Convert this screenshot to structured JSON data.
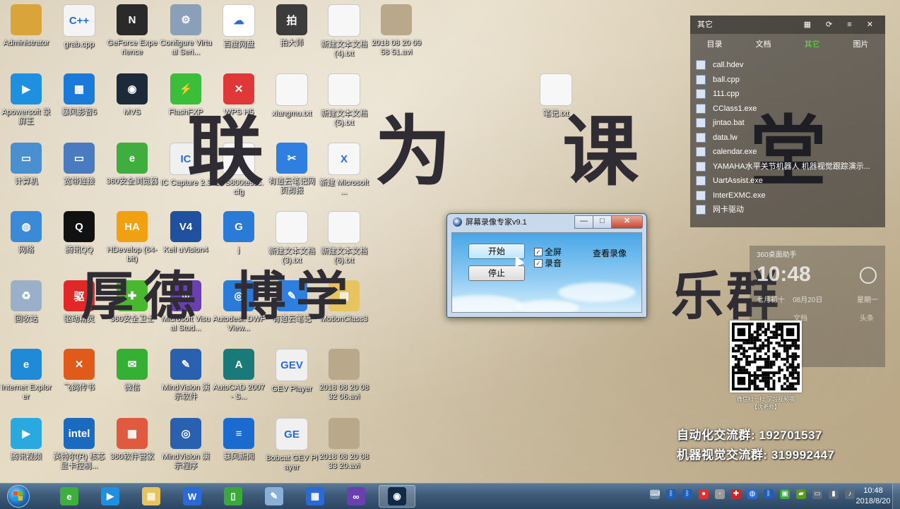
{
  "desktop": {
    "icons": [
      {
        "label": "Administrator",
        "color": "#d9a53a",
        "glyph": ""
      },
      {
        "label": "grab.cpp",
        "color": "#f4f4f4",
        "glyph": "C++"
      },
      {
        "label": "GeForce Experience",
        "color": "#2a2a2a",
        "glyph": "N"
      },
      {
        "label": "Configure Virtual Seri...",
        "color": "#8aa0b8",
        "glyph": "⚙"
      },
      {
        "label": "百度网盘",
        "color": "#ffffff",
        "glyph": "☁"
      },
      {
        "label": "拍大师",
        "color": "#3c3c3c",
        "glyph": "拍"
      },
      {
        "label": "新建文本文档 (4).txt",
        "color": "#f7f7f7",
        "glyph": ""
      },
      {
        "label": "2018 08 20 09 58 51.avi",
        "color": "#b9a98a",
        "glyph": ""
      },
      {
        "label": "Apowersoft 录屏王",
        "color": "#1f8fe0",
        "glyph": "▶"
      },
      {
        "label": "暴风影音5",
        "color": "#1a7ad9",
        "glyph": "▦"
      },
      {
        "label": "MVS",
        "color": "#1c2a3a",
        "glyph": "◉"
      },
      {
        "label": "FlashFXP",
        "color": "#3bbf3b",
        "glyph": "⚡"
      },
      {
        "label": "WPS H5",
        "color": "#e03838",
        "glyph": "✕"
      },
      {
        "label": "xiangmu.txt",
        "color": "#f7f7f7",
        "glyph": ""
      },
      {
        "label": "新建文本文档 (5).txt",
        "color": "#f7f7f7",
        "glyph": ""
      },
      {
        "label": "笔记.txt",
        "color": "#f7f7f7",
        "glyph": ""
      },
      {
        "label": "计算机",
        "color": "#4a8fd0",
        "glyph": "▭"
      },
      {
        "label": "宽带连接",
        "color": "#4a7ac0",
        "glyph": "▭"
      },
      {
        "label": "360安全浏览器",
        "color": "#3fae3f",
        "glyph": "e"
      },
      {
        "label": "IC Capture 2.3",
        "color": "#f0f0f0",
        "glyph": "IC"
      },
      {
        "label": "GTS800testic.cfg",
        "color": "#f7f7f7",
        "glyph": ""
      },
      {
        "label": "有道云笔记网页剪报",
        "color": "#2e7fe0",
        "glyph": "✂"
      },
      {
        "label": "新建 Microsoft ...",
        "color": "#f7f7f7",
        "glyph": "X"
      },
      {
        "label": "网络",
        "color": "#3a8ad8",
        "glyph": "◍"
      },
      {
        "label": "腾讯QQ",
        "color": "#111111",
        "glyph": "Q"
      },
      {
        "label": "HDevelop (64-bit)",
        "color": "#f0a010",
        "glyph": "HA"
      },
      {
        "label": "Keil uVision4",
        "color": "#2050a0",
        "glyph": "V4"
      },
      {
        "label": "j",
        "color": "#2a7ad8",
        "glyph": "G"
      },
      {
        "label": "新建文本文档 (3).txt",
        "color": "#f7f7f7",
        "glyph": ""
      },
      {
        "label": "新建文本文档 (6).txt",
        "color": "#f7f7f7",
        "glyph": ""
      },
      {
        "label": "回收站",
        "color": "#9ab0c8",
        "glyph": "♻"
      },
      {
        "label": "驱动精灵",
        "color": "#e02828",
        "glyph": "驱"
      },
      {
        "label": "360安全卫士",
        "color": "#49b82e",
        "glyph": "✚"
      },
      {
        "label": "Microsoft Visual Stud...",
        "color": "#6a3fb0",
        "glyph": "∞"
      },
      {
        "label": "Autodesk DWF View...",
        "color": "#2a7ad8",
        "glyph": "◎"
      },
      {
        "label": "有道云笔记",
        "color": "#2e7fe0",
        "glyph": "✎"
      },
      {
        "label": "MotionClass3",
        "color": "#e8c460",
        "glyph": "▤"
      },
      {
        "label": "Internet Explorer",
        "color": "#1e8ad8",
        "glyph": "e"
      },
      {
        "label": "飞鸽传书",
        "color": "#e05a1a",
        "glyph": "✕"
      },
      {
        "label": "微信",
        "color": "#35b035",
        "glyph": "✉"
      },
      {
        "label": "MindVision 演示软件",
        "color": "#2a60b0",
        "glyph": "✎"
      },
      {
        "label": "AutoCAD 2007 - S...",
        "color": "#1a7a7a",
        "glyph": "A"
      },
      {
        "label": "GEV Player",
        "color": "#f0f0f0",
        "glyph": "GEV"
      },
      {
        "label": "2018 08 20 08 32 06.avi",
        "color": "#b9a98a",
        "glyph": ""
      },
      {
        "label": "腾讯视频",
        "color": "#2aa8e0",
        "glyph": "▶"
      },
      {
        "label": "英特尔(R) 核芯显卡控制...",
        "color": "#1a6ac0",
        "glyph": "intel"
      },
      {
        "label": "360软件管家",
        "color": "#e05a40",
        "glyph": "▦"
      },
      {
        "label": "MindVision 演示程序",
        "color": "#2a60b0",
        "glyph": "◎"
      },
      {
        "label": "暴风新闻",
        "color": "#1a6ad0",
        "glyph": "≡"
      },
      {
        "label": "Bobcat GEV Player",
        "color": "#f0f0f0",
        "glyph": "GE"
      },
      {
        "label": "2018 08 20 08 33 20.avi",
        "color": "#b9a98a",
        "glyph": ""
      }
    ]
  },
  "wallpaper": {
    "title_line1": "联 为 课 堂",
    "title_line2_left": "厚德 博学",
    "title_line2_right": "乐群",
    "group_lines": [
      "自动化交流群: 192701537",
      "机器视觉交流群: 319992447"
    ],
    "qr_caption": "微信扫一扫 学习视频哦\n【沈老师】"
  },
  "side_panel": {
    "title": "其它",
    "tabs": [
      "目录",
      "文档",
      "其它",
      "图片"
    ],
    "active_tab": "其它",
    "files": [
      "call.hdev",
      "ball.cpp",
      "111.cpp",
      "CClass1.exe",
      "jintao.bat",
      "data.lw",
      "calendar.exe",
      "YAMAHA水平关节机器人 机器视觉跟踪演示...",
      "UartAssist.exe",
      "InterEXMC.exe",
      "网卡驱动"
    ]
  },
  "clock_widget": {
    "title": "360桌面助手",
    "time": "10:48",
    "lunar": "七月初十",
    "date": "08月20日",
    "weekday": "星期一",
    "search": "文档",
    "download": "头条"
  },
  "recorder": {
    "title": "屏幕录像专家v9.1",
    "start_label": "开始",
    "stop_label": "停止",
    "fullscreen_label": "全屏",
    "audio_label": "录音",
    "fullscreen_checked": true,
    "audio_checked": true,
    "view_label": "查看录像",
    "close_glyph": "✕",
    "min_glyph": "—",
    "max_glyph": "□"
  },
  "taskbar": {
    "items": [
      {
        "name": "360-browser",
        "color": "#3fae3f",
        "glyph": "e"
      },
      {
        "name": "video-app",
        "color": "#1f8fe0",
        "glyph": "▶"
      },
      {
        "name": "file-explorer",
        "color": "#e8c460",
        "glyph": "▤"
      },
      {
        "name": "wps-writer",
        "color": "#2a6ad8",
        "glyph": "W"
      },
      {
        "name": "plugin-app",
        "color": "#3aa83a",
        "glyph": "▯"
      },
      {
        "name": "paint-app",
        "color": "#8ab0d8",
        "glyph": "✎"
      },
      {
        "name": "recorder-app",
        "color": "#2a6ad8",
        "glyph": "▦"
      },
      {
        "name": "visual-studio",
        "color": "#6a3fb0",
        "glyph": "∞"
      },
      {
        "name": "hdevelop",
        "color": "#102a48",
        "glyph": "◉"
      }
    ],
    "active_index": 8,
    "clock_time": "10:48",
    "clock_date": "2018/8/20"
  }
}
